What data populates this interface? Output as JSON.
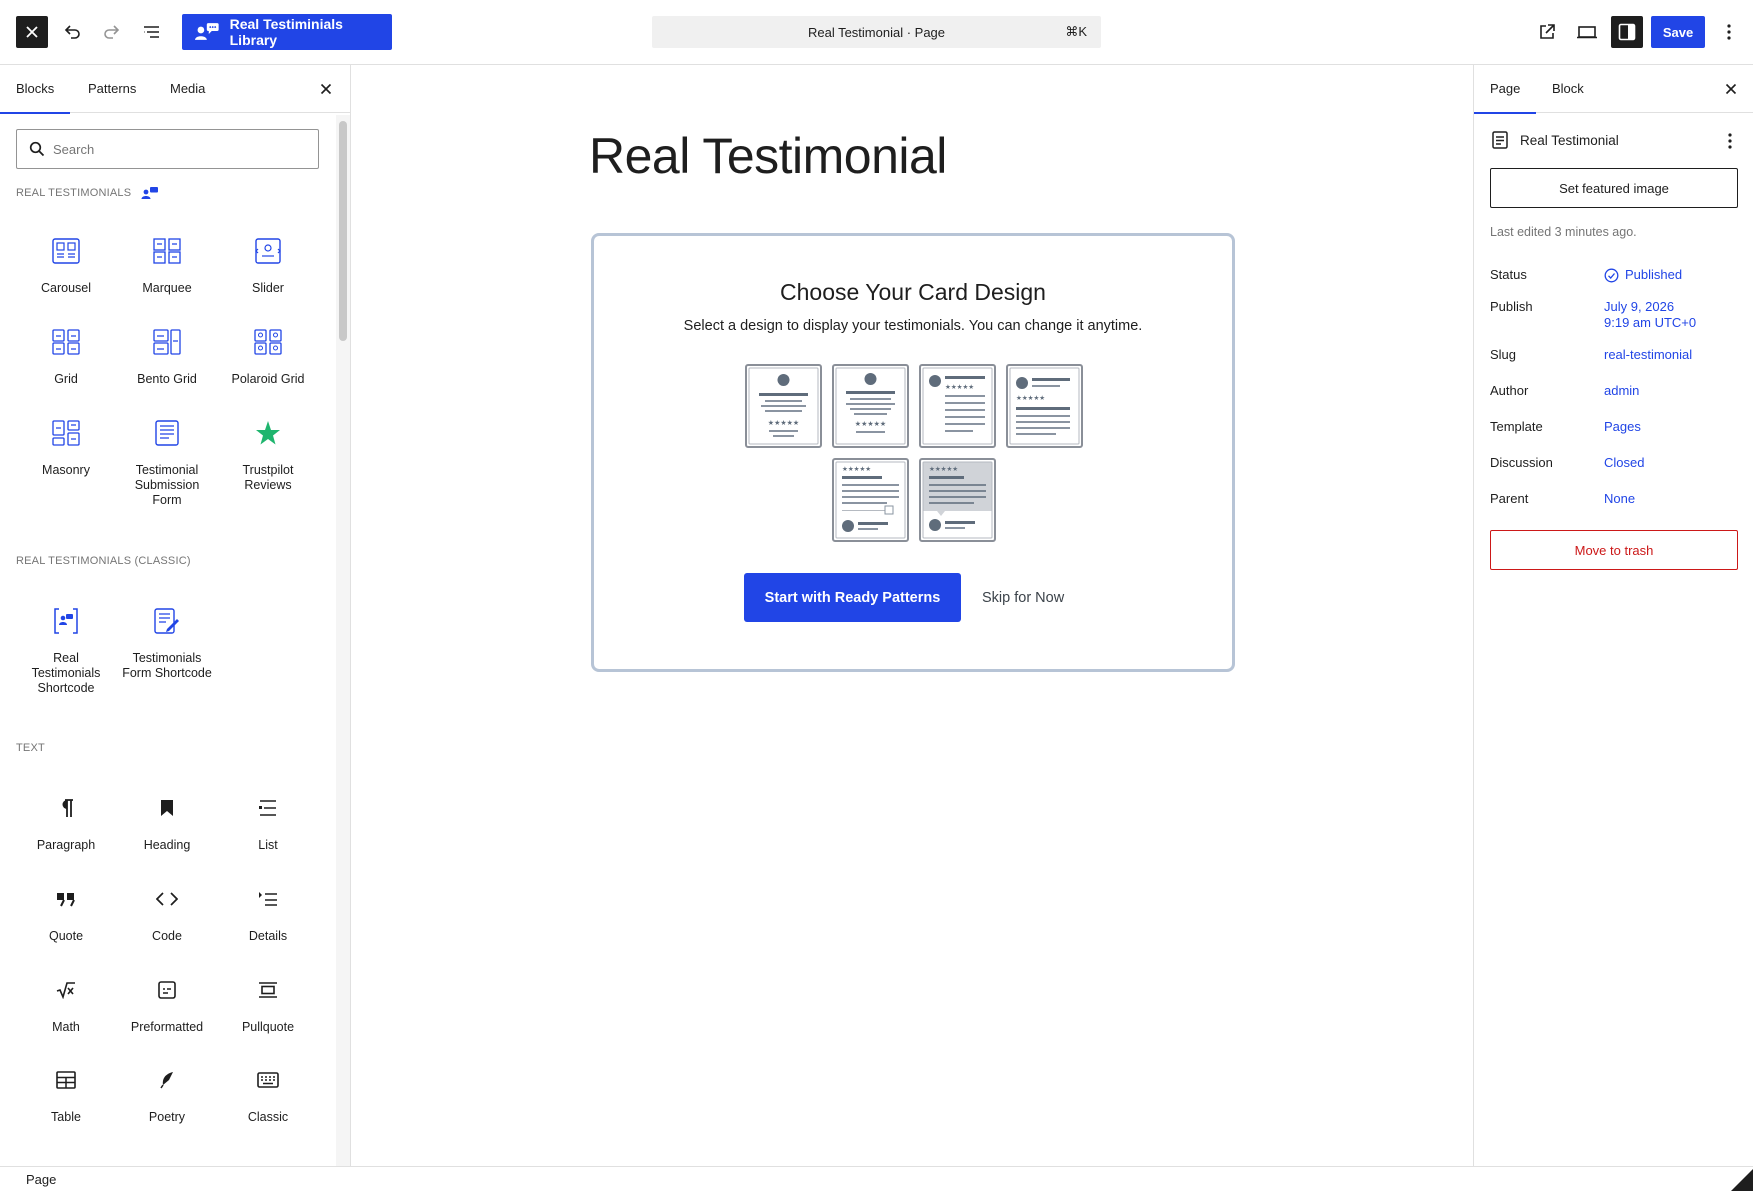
{
  "toolbar": {
    "library_label": "Real Testiminials Library",
    "command_label": "Real Testimonial · Page",
    "command_shortcut": "⌘K",
    "save_label": "Save"
  },
  "inserter": {
    "tabs": [
      "Blocks",
      "Patterns",
      "Media"
    ],
    "search_placeholder": "Search",
    "categories": [
      {
        "title": "REAL TESTIMONIALS",
        "blocks": [
          "Carousel",
          "Marquee",
          "Slider",
          "Grid",
          "Bento Grid",
          "Polaroid Grid",
          "Masonry",
          "Testimonial Submission Form",
          "Trustpilot Reviews"
        ]
      },
      {
        "title": "REAL TESTIMONIALS (CLASSIC)",
        "blocks": [
          "Real Testimonials Shortcode",
          "Testimonials Form Shortcode"
        ]
      },
      {
        "title": "TEXT",
        "blocks": [
          "Paragraph",
          "Heading",
          "List",
          "Quote",
          "Code",
          "Details",
          "Math",
          "Preformatted",
          "Pullquote",
          "Table",
          "Poetry",
          "Classic"
        ]
      }
    ]
  },
  "canvas": {
    "page_title": "Real Testimonial",
    "card_title": "Choose Your Card Design",
    "card_subtitle": "Select a design to display your testimonials. You can change it anytime.",
    "primary_button": "Start with Ready Patterns",
    "skip_button": "Skip for Now",
    "thumbnail_stars": "★★★★★"
  },
  "settings": {
    "tabs": [
      "Page",
      "Block"
    ],
    "doc_title": "Real Testimonial",
    "featured_image_button": "Set featured image",
    "last_edited": "Last edited 3 minutes ago.",
    "rows": [
      {
        "label": "Status",
        "value": "Published"
      },
      {
        "label": "Publish",
        "value": "July 9, 2026",
        "value2": "9:19 am UTC+0"
      },
      {
        "label": "Slug",
        "value": "real-testimonial"
      },
      {
        "label": "Author",
        "value": "admin"
      },
      {
        "label": "Template",
        "value": "Pages"
      },
      {
        "label": "Discussion",
        "value": "Closed"
      },
      {
        "label": "Parent",
        "value": "None"
      }
    ],
    "trash_button": "Move to trash"
  },
  "footer": {
    "breadcrumb": "Page"
  },
  "colors": {
    "accent": "#2145e6",
    "dark": "#1e1e1e",
    "danger": "#cc1818",
    "muted": "#757575",
    "trustpilot_green": "#1fb56e"
  }
}
